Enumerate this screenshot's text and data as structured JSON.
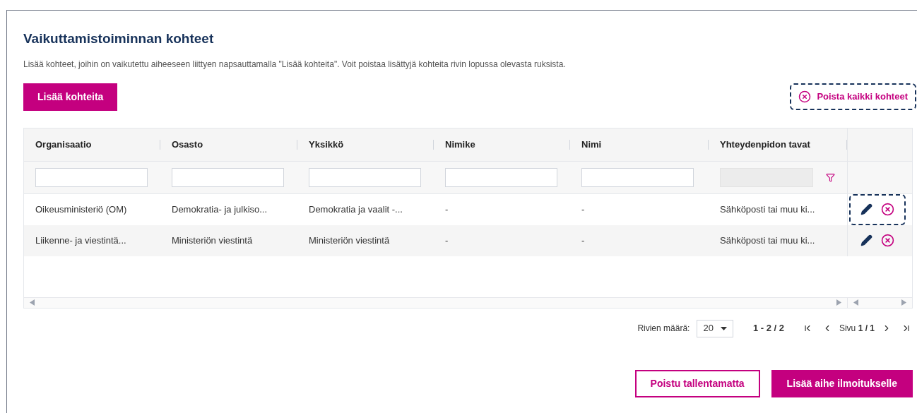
{
  "title": "Vaikuttamistoiminnan kohteet",
  "description": "Lisää kohteet, joihin on vaikutettu aiheeseen liittyen napsauttamalla \"Lisää kohteita\". Voit poistaa lisättyjä kohteita rivin lopussa olevasta ruksista.",
  "add_button": {
    "label": "Lisää kohteita"
  },
  "remove_all_button": {
    "label": "Poista kaikki kohteet",
    "focused": true
  },
  "table": {
    "columns": [
      "Organisaatio",
      "Osasto",
      "Yksikkö",
      "Nimike",
      "Nimi",
      "Yhteydenpidon tavat"
    ],
    "filters": [
      {
        "kind": "text",
        "disabled": false
      },
      {
        "kind": "text",
        "disabled": false
      },
      {
        "kind": "text",
        "disabled": false
      },
      {
        "kind": "text",
        "disabled": false
      },
      {
        "kind": "text",
        "disabled": false
      },
      {
        "kind": "filter",
        "disabled": true
      }
    ],
    "rows": [
      {
        "cells": [
          "Oikeusministeriö (OM)",
          "Demokratia- ja julkiso...",
          "Demokratia ja vaalit -...",
          "-",
          "-",
          "Sähköposti tai muu ki..."
        ],
        "actions_focused": true
      },
      {
        "cells": [
          "Liikenne- ja viestintä...",
          "Ministeriön viestintä",
          "Ministeriön viestintä",
          "-",
          "-",
          "Sähköposti tai muu ki..."
        ],
        "actions_focused": false
      }
    ]
  },
  "pagination": {
    "rows_label": "Rivien määrä:",
    "page_size": "20",
    "range": "1 - 2 / 2",
    "page": "Sivu **1 / 1**"
  },
  "footer_buttons": [
    {
      "label": "Poistu tallentamatta",
      "kind": "secondary"
    },
    {
      "label": "Lisää aihe ilmoitukselle",
      "kind": "primary"
    }
  ]
}
